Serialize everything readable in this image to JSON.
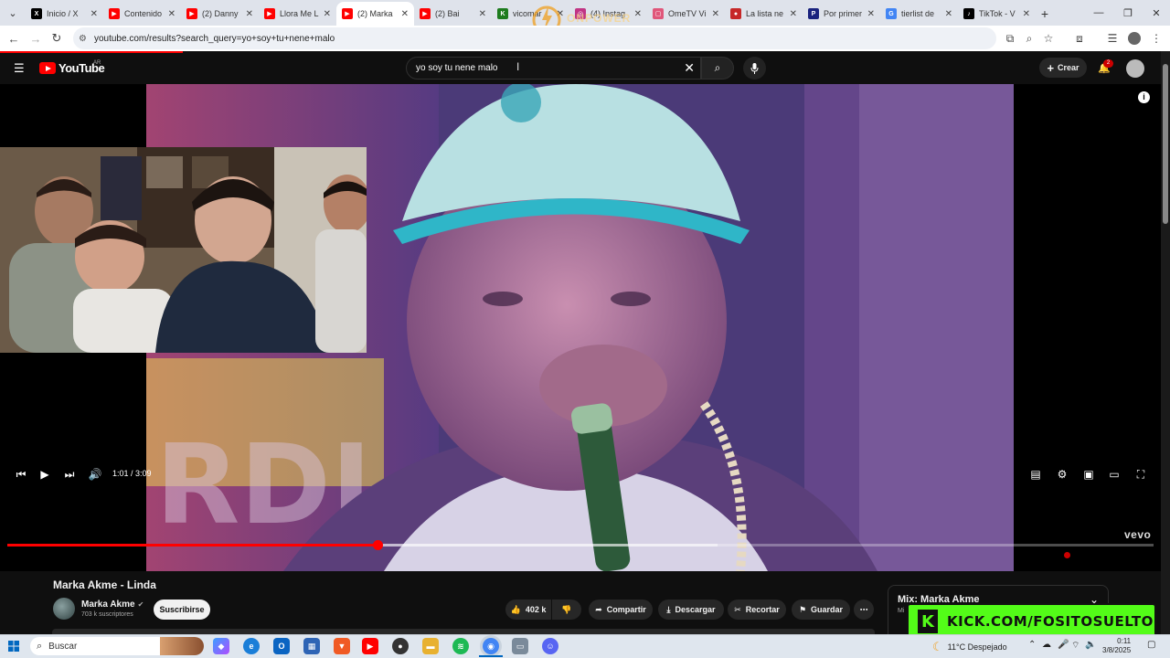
{
  "browser": {
    "tabs": [
      {
        "title": "Inicio / X",
        "fav_color": "#000000",
        "fav_glyph": "X",
        "active": false
      },
      {
        "title": "Contenido",
        "fav_color": "#ff0000",
        "fav_glyph": "▶",
        "active": false
      },
      {
        "title": "(2) Danny",
        "fav_color": "#ff0000",
        "fav_glyph": "▶",
        "active": false
      },
      {
        "title": "Llora Me L",
        "fav_color": "#ff0000",
        "fav_glyph": "▶",
        "active": false
      },
      {
        "title": "(2) Marka",
        "fav_color": "#ff0000",
        "fav_glyph": "▶",
        "active": true
      },
      {
        "title": "(2) Bai",
        "fav_color": "#ff0000",
        "fav_glyph": "▶",
        "active": false
      },
      {
        "title": "vicomar",
        "fav_color": "#1e7c1e",
        "fav_glyph": "K",
        "active": false
      },
      {
        "title": "(4) Instag",
        "fav_color": "#c13584",
        "fav_glyph": "◎",
        "active": false
      },
      {
        "title": "OmeTV Vi",
        "fav_color": "#e0567a",
        "fav_glyph": "▢",
        "active": false
      },
      {
        "title": "La lista ne",
        "fav_color": "#c62828",
        "fav_glyph": "●",
        "active": false
      },
      {
        "title": "Por primer",
        "fav_color": "#1a237e",
        "fav_glyph": "P",
        "active": false
      },
      {
        "title": "tierlist de",
        "fav_color": "#4285f4",
        "fav_glyph": "G",
        "active": false
      },
      {
        "title": "TikTok - V",
        "fav_color": "#000000",
        "fav_glyph": "♪",
        "active": false
      }
    ],
    "url": "youtube.com/results?search_query=yo+soy+tu+nene+malo",
    "watermark": "ONPOWER"
  },
  "youtube": {
    "logo_text": "YouTube",
    "country": "AR",
    "search_value": "yo soy tu nene malo",
    "create_label": "Crear",
    "notif_count": "2"
  },
  "player": {
    "time": "1:01 / 3:09",
    "progress_fraction": 0.323,
    "buffer_fraction": 0.62,
    "brand": "vevo"
  },
  "video": {
    "title": "Marka Akme - Linda",
    "channel": "Marka Akme",
    "subscribers": "703 k suscriptores",
    "subscribe_label": "Suscribirse",
    "likes": "402 k",
    "share_label": "Compartir",
    "download_label": "Descargar",
    "clip_label": "Recortar",
    "save_label": "Guardar"
  },
  "mix": {
    "title": "Mix: Marka Akme",
    "subtitle": "Mi"
  },
  "overlay": {
    "kick_text": "KICK.COM/FOSITOSUELTO"
  },
  "taskbar": {
    "search_label": "Buscar",
    "weather": "11°C  Despejado",
    "date": "3/8/2025",
    "time": "0:11"
  },
  "colors": {
    "yt_red": "#ff0000",
    "kick_green": "#53fc18"
  }
}
